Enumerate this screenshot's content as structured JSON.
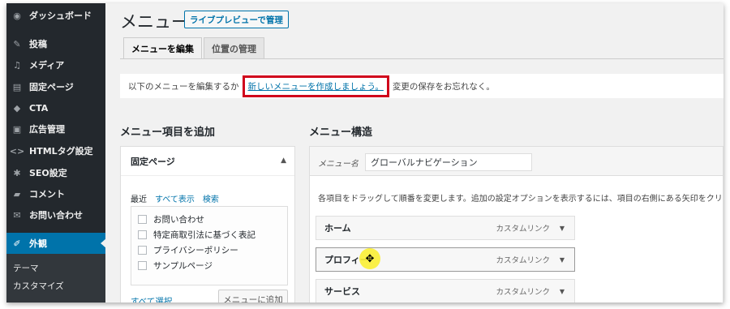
{
  "sidebar": {
    "items": [
      {
        "label": "ダッシュボード",
        "icon": "dashboard-icon",
        "glyph": "◉"
      },
      {
        "label": "投稿",
        "icon": "pin-icon",
        "glyph": "✎"
      },
      {
        "label": "メディア",
        "icon": "media-icon",
        "glyph": "♫"
      },
      {
        "label": "固定ページ",
        "icon": "page-icon",
        "glyph": "▤"
      },
      {
        "label": "CTA",
        "icon": "tag-icon",
        "glyph": "◆"
      },
      {
        "label": "広告管理",
        "icon": "ad-icon",
        "glyph": "▣"
      },
      {
        "label": "HTMLタグ設定",
        "icon": "code-icon",
        "glyph": "<>"
      },
      {
        "label": "SEO設定",
        "icon": "gear-icon",
        "glyph": "✱"
      },
      {
        "label": "コメント",
        "icon": "comment-icon",
        "glyph": "▰"
      },
      {
        "label": "お問い合わせ",
        "icon": "mail-icon",
        "glyph": "✉"
      },
      {
        "label": "外観",
        "icon": "brush-icon",
        "glyph": "✐"
      }
    ],
    "submenu": [
      "テーマ",
      "カスタマイズ"
    ]
  },
  "header": {
    "title": "メニュー",
    "live_preview": "ライブプレビューで管理"
  },
  "tabs": [
    {
      "label": "メニューを編集"
    },
    {
      "label": "位置の管理"
    }
  ],
  "notice": {
    "before": "以下のメニューを編集するか",
    "link": "新しいメニューを作成しましょう。",
    "after": "変更の保存をお忘れなく。"
  },
  "add_items": {
    "heading": "メニュー項目を追加",
    "accordion_title": "固定ページ",
    "subtabs": [
      "最近",
      "すべて表示",
      "検索"
    ],
    "pages": [
      "お問い合わせ",
      "特定商取引法に基づく表記",
      "プライバシーポリシー",
      "サンプルページ"
    ],
    "select_all": "すべて選択",
    "add_button": "メニューに追加"
  },
  "structure": {
    "heading": "メニュー構造",
    "name_label": "メニュー名",
    "name_value": "グローバルナビゲーション",
    "instructions": "各項目をドラッグして順番を変更します。追加の設定オプションを表示するには、項目の右側にある矢印をクリ",
    "items": [
      {
        "title": "ホーム",
        "type": "カスタムリンク"
      },
      {
        "title": "プロフィー",
        "type": "カスタムリンク"
      },
      {
        "title": "サービス",
        "type": "カスタムリンク"
      }
    ],
    "cursor_glyph": "✥"
  },
  "colors": {
    "sidebar_bg": "#23282d",
    "accent": "#0073aa",
    "highlight_border": "#d0021b",
    "cursor_highlight": "#f9ee34"
  }
}
